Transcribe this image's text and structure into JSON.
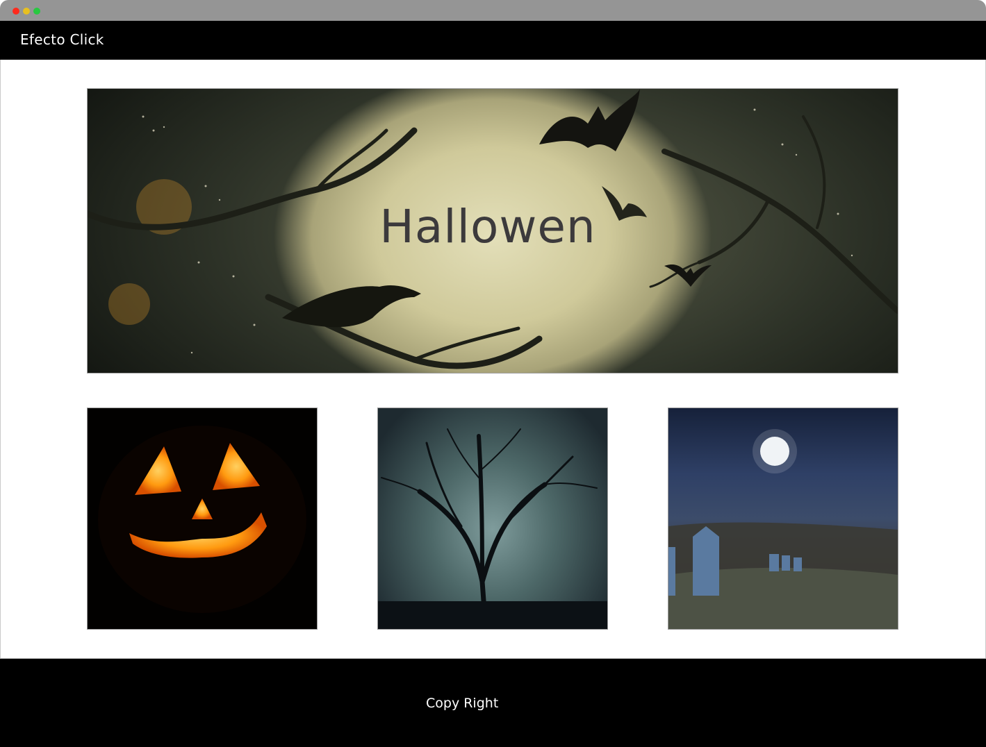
{
  "window": {
    "controls": [
      "close",
      "minimize",
      "zoom"
    ]
  },
  "navbar": {
    "brand": "Efecto Click"
  },
  "hero": {
    "title": "Hallowen",
    "image": "full-moon-crow-bats-illustration"
  },
  "gallery": [
    {
      "image": "jack-o-lantern-photo"
    },
    {
      "image": "bare-tree-silhouette-photo"
    },
    {
      "image": "graveyard-full-moon-photo"
    }
  ],
  "footer": {
    "text": "Copy Right"
  },
  "colors": {
    "navbar": "#000000",
    "footer": "#000000",
    "hero_title": "#3c3a3c",
    "titlebar": "#959595"
  }
}
